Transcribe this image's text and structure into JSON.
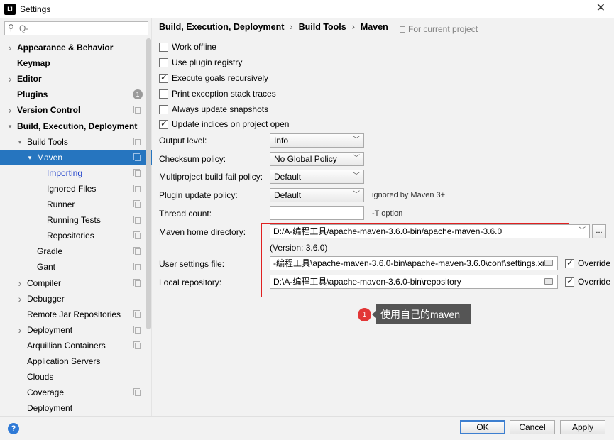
{
  "window": {
    "title": "Settings",
    "app_icon_text": "IJ"
  },
  "sidebar": {
    "search_placeholder": "Q-",
    "items": [
      {
        "label": "Appearance & Behavior",
        "arrow": "right",
        "bold": true
      },
      {
        "label": "Keymap",
        "bold": true
      },
      {
        "label": "Editor",
        "arrow": "right",
        "bold": true
      },
      {
        "label": "Plugins",
        "bold": true,
        "badge": "1"
      },
      {
        "label": "Version Control",
        "arrow": "right",
        "bold": true,
        "copy": true
      },
      {
        "label": "Build, Execution, Deployment",
        "arrow": "down",
        "bold": true
      },
      {
        "label": "Build Tools",
        "arrow": "down",
        "copy": true
      },
      {
        "label": "Maven",
        "arrow": "down",
        "copy": true,
        "selected": true
      },
      {
        "label": "Importing",
        "copy": true,
        "link": true
      },
      {
        "label": "Ignored Files",
        "copy": true
      },
      {
        "label": "Runner",
        "copy": true
      },
      {
        "label": "Running Tests",
        "copy": true
      },
      {
        "label": "Repositories",
        "copy": true
      },
      {
        "label": "Gradle",
        "copy": true
      },
      {
        "label": "Gant",
        "copy": true
      },
      {
        "label": "Compiler",
        "arrow": "right",
        "copy": true
      },
      {
        "label": "Debugger",
        "arrow": "right"
      },
      {
        "label": "Remote Jar Repositories",
        "copy": true
      },
      {
        "label": "Deployment",
        "arrow": "right",
        "copy": true
      },
      {
        "label": "Arquillian Containers",
        "copy": true
      },
      {
        "label": "Application Servers"
      },
      {
        "label": "Clouds"
      },
      {
        "label": "Coverage",
        "copy": true
      },
      {
        "label": "Deployment"
      }
    ]
  },
  "breadcrumb": [
    "Build, Execution, Deployment",
    "Build Tools",
    "Maven"
  ],
  "breadcrumb_sep": "›",
  "project_note": "For current project",
  "checkboxes": [
    {
      "label": "Work offline",
      "checked": false
    },
    {
      "label": "Use plugin registry",
      "checked": false
    },
    {
      "label": "Execute goals recursively",
      "checked": true
    },
    {
      "label": "Print exception stack traces",
      "checked": false
    },
    {
      "label": "Always update snapshots",
      "checked": false
    },
    {
      "label": "Update indices on project open",
      "checked": true
    }
  ],
  "fields": {
    "output_level": {
      "label": "Output level:",
      "value": "Info"
    },
    "checksum_policy": {
      "label": "Checksum policy:",
      "value": "No Global Policy"
    },
    "multiproject_fail": {
      "label": "Multiproject build fail policy:",
      "value": "Default"
    },
    "plugin_update": {
      "label": "Plugin update policy:",
      "value": "Default",
      "hint": "ignored by Maven 3+"
    },
    "thread_count": {
      "label": "Thread count:",
      "value": "",
      "hint": "-T option"
    },
    "maven_home": {
      "label": "Maven home directory:",
      "value": "D:/A-编程工具/apache-maven-3.6.0-bin/apache-maven-3.6.0",
      "version": "(Version: 3.6.0)",
      "browse": "..."
    },
    "user_settings": {
      "label": "User settings file:",
      "value": "-编程工具\\apache-maven-3.6.0-bin\\apache-maven-3.6.0\\conf\\settings.xml",
      "override_label": "Override",
      "override_checked": true
    },
    "local_repo": {
      "label": "Local repository:",
      "value": "D:\\A-编程工具\\apache-maven-3.6.0-bin\\repository",
      "override_label": "Override",
      "override_checked": true
    }
  },
  "annotation": {
    "number": "1",
    "text": "使用自己的maven"
  },
  "footer": {
    "help": "?",
    "ok": "OK",
    "cancel": "Cancel",
    "apply": "Apply"
  }
}
